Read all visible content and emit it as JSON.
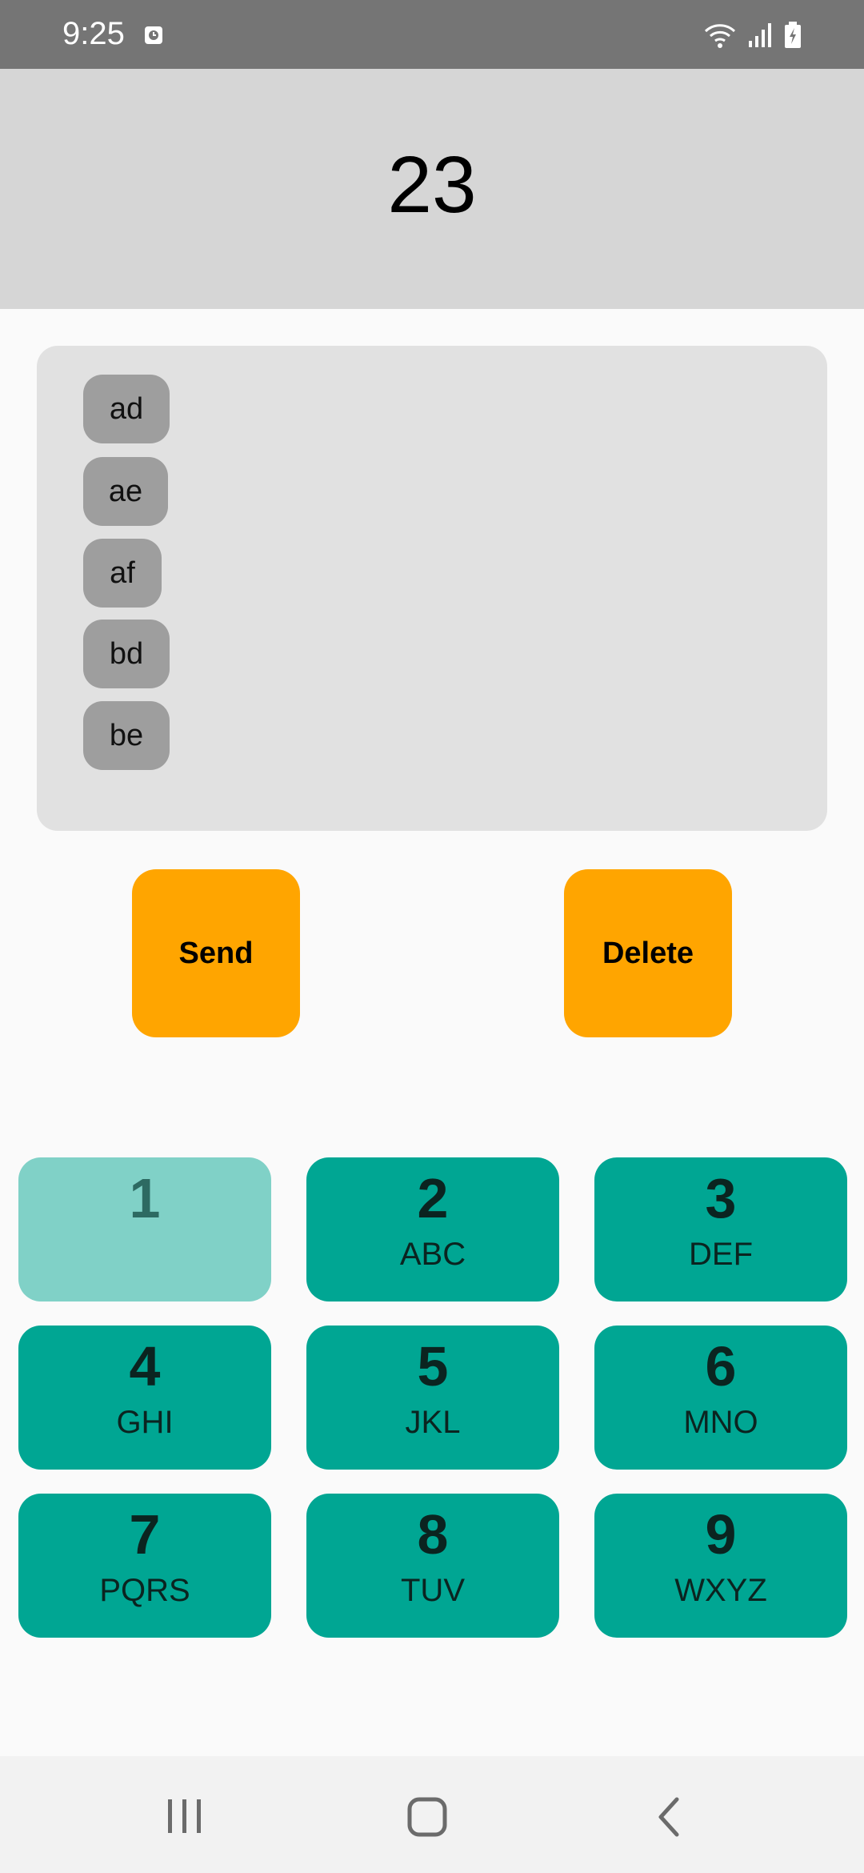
{
  "status_bar": {
    "time": "9:25",
    "icons": [
      "clock-icon",
      "wifi-icon",
      "signal-icon",
      "battery-charging-icon"
    ]
  },
  "display": {
    "number": "23"
  },
  "suggestions": [
    "ad",
    "ae",
    "af",
    "bd",
    "be"
  ],
  "actions": {
    "send_label": "Send",
    "delete_label": "Delete",
    "color": "#ffa500"
  },
  "keypad": {
    "color_active": "#00a693",
    "color_disabled": "#80d1c7",
    "keys": [
      {
        "digit": "1",
        "letters": ""
      },
      {
        "digit": "2",
        "letters": "ABC"
      },
      {
        "digit": "3",
        "letters": "DEF"
      },
      {
        "digit": "4",
        "letters": "GHI"
      },
      {
        "digit": "5",
        "letters": "JKL"
      },
      {
        "digit": "6",
        "letters": "MNO"
      },
      {
        "digit": "7",
        "letters": "PQRS"
      },
      {
        "digit": "8",
        "letters": "TUV"
      },
      {
        "digit": "9",
        "letters": "WXYZ"
      }
    ]
  },
  "nav_bar": {
    "icons": [
      "recents-icon",
      "home-icon",
      "back-icon"
    ]
  }
}
